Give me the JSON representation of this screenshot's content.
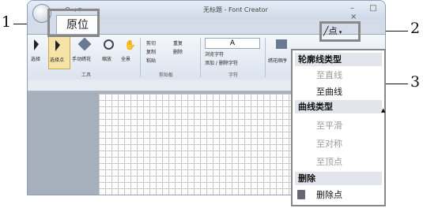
{
  "callouts": [
    "1",
    "2",
    "3"
  ],
  "window": {
    "title": "无标题 - Font Creator",
    "qat": "↶  ◂  ▾",
    "win_buttons": "–  □  ×"
  },
  "tab": {
    "label": "原位"
  },
  "ribbon": {
    "tools": {
      "items": [
        "选择",
        "选择点",
        "手动绣花",
        "缩放",
        "全景"
      ],
      "group_label": "工具"
    },
    "clipboard": {
      "items": [
        "剪切",
        "复制",
        "粘贴",
        "重复",
        "删除"
      ],
      "group_label": "剪贴板"
    },
    "text": {
      "char": "A",
      "browse_label": "浏览字符",
      "add_remove_label": "添加 / 删除字符",
      "group_label": "字符"
    },
    "extra": {
      "label": "绣花顺序"
    }
  },
  "point_button": {
    "label": "点"
  },
  "menu": {
    "section1": "轮廓线类型",
    "to_straight": "至直线",
    "to_curve": "至曲线",
    "section2": "曲线类型",
    "to_smooth": "至平滑",
    "to_symmetric": "至对称",
    "to_corner": "至顶点",
    "section3": "删除",
    "delete_point": "删除点"
  },
  "colors": {
    "disabled_text": "#9a9a9a",
    "highlight_border": "#888888",
    "ribbon_bg": "#dbe3ee"
  }
}
